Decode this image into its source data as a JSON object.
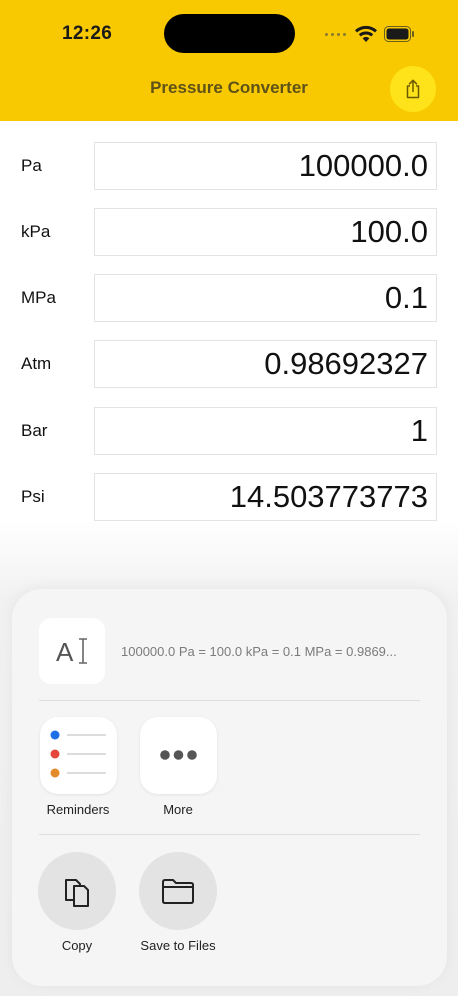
{
  "status_bar": {
    "time": "12:26"
  },
  "nav": {
    "title": "Pressure Converter",
    "share_icon": "share-icon"
  },
  "rows": [
    {
      "label": "Pa",
      "value": "100000.0"
    },
    {
      "label": "kPa",
      "value": "100.0"
    },
    {
      "label": "MPa",
      "value": "0.1"
    },
    {
      "label": "Atm",
      "value": "0.98692327"
    },
    {
      "label": "Bar",
      "value": "1"
    },
    {
      "label": "Psi",
      "value": "14.503773773"
    }
  ],
  "share_sheet": {
    "preview_text": "100000.0 Pa = 100.0 kPa = 0.1 MPa = 0.9869...",
    "apps": [
      {
        "label": "Reminders",
        "icon": "reminders-icon"
      },
      {
        "label": "More",
        "icon": "more-icon"
      }
    ],
    "actions": [
      {
        "label": "Copy",
        "icon": "copy-icon"
      },
      {
        "label": "Save to Files",
        "icon": "folder-icon"
      }
    ]
  },
  "colors": {
    "header": "#f8c900",
    "share_button": "#ffe31a",
    "title_text": "#5e5218"
  }
}
